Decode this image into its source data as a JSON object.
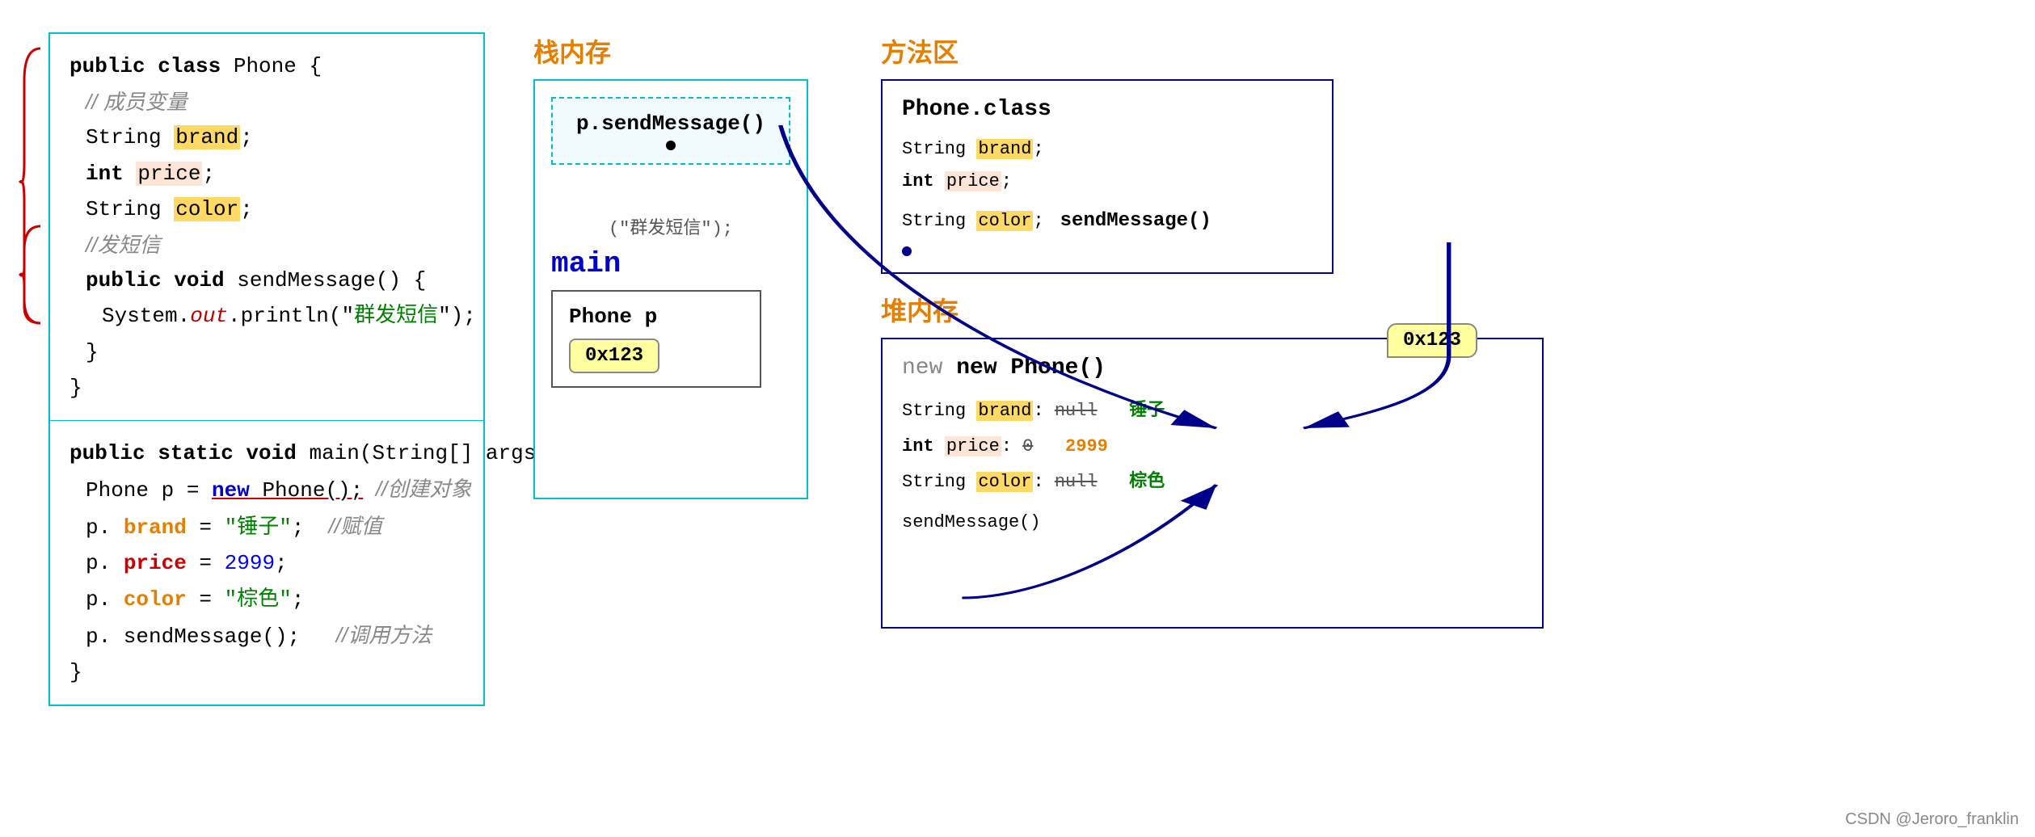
{
  "left_panel": {
    "class_code": {
      "line1": "public class Phone {",
      "line2": "    // 成员变量",
      "line3_pre": "    String ",
      "line3_field": "brand",
      "line3_post": ";",
      "line4_pre": "    int ",
      "line4_field": "price",
      "line4_post": ";",
      "line5_pre": "    String ",
      "line5_field": "color",
      "line5_post": ";",
      "line6": "    //发短信",
      "line7": "    public void sendMessage() {",
      "line8_pre": "        System.",
      "line8_mid": "out",
      "line8_post": ".println(\"群发短信\");",
      "line9": "    }",
      "line10": "}"
    },
    "main_code": {
      "line1": "public static void main(String[] args) {",
      "line2_pre": "    Phone p = ",
      "line2_new": "new",
      "line2_post": " Phone(); //创建对象",
      "line3_pre": "    p.",
      "line3_field": "brand",
      "line3_post": " = \"锤子\";    //赋值",
      "line4_pre": "    p.",
      "line4_field": "price",
      "line4_post": " = 2999;",
      "line5_pre": "    p.",
      "line5_field": "color",
      "line5_post": " = \"棕色\";",
      "line6_pre": "    p.sendMessage();",
      "line6_post": "    //调用方法",
      "line7": "}"
    }
  },
  "diagram": {
    "stack_title": "栈内存",
    "stack_method": "p.sendMessage()",
    "stack_string": "(\"群发短信\");",
    "main_label": "main",
    "phone_p_label": "Phone  p",
    "address_0x123": "0x123",
    "method_title": "方法区",
    "phone_class": "Phone.class",
    "method_field1_pre": "String ",
    "method_field1": "brand",
    "method_field1_post": ";",
    "method_field2_pre": "int ",
    "method_field2": "price",
    "method_field2_post": ";",
    "method_field3_pre": "String ",
    "method_field3": "color",
    "method_field3_post": ";",
    "method_send": "sendMessage()",
    "heap_title": "堆内存",
    "new_phone": "new Phone()",
    "heap_address": "0x123",
    "heap_field1_pre": "String ",
    "heap_field1": "brand",
    "heap_field1_null": "null",
    "heap_field1_val": "锤子",
    "heap_field2_pre": "int ",
    "heap_field2": "price",
    "heap_field2_null": "0",
    "heap_field2_val": "2999",
    "heap_field3_pre": "String ",
    "heap_field3": "color",
    "heap_field3_null": "null",
    "heap_field3_val": "棕色",
    "heap_send": "sendMessage()"
  },
  "watermark": "CSDN @Jeroro_franklin"
}
